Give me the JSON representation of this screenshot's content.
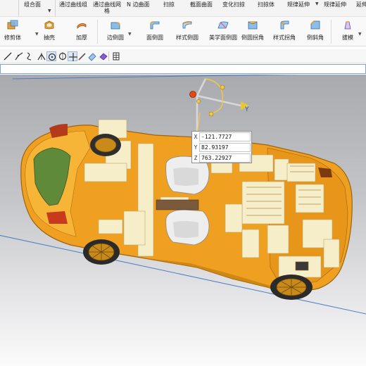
{
  "ribbon_top": {
    "groups": [
      "组合面",
      "通过曲线组",
      "通过曲线网格",
      "N 边曲面",
      "扫掠",
      "截面曲面",
      "变化扫掠",
      "扫掠体",
      "规律延伸",
      "规律延伸",
      "延伸"
    ]
  },
  "ribbon": {
    "buttons": [
      {
        "label": "修剪体",
        "icon": "trim-body-icon"
      },
      {
        "label": "抽壳",
        "icon": "shell-icon"
      },
      {
        "label": "加厚",
        "icon": "thicken-icon"
      },
      {
        "label": "边倒圆",
        "icon": "edge-blend-icon"
      },
      {
        "label": "面倒圆",
        "icon": "face-blend-icon"
      },
      {
        "label": "样式倒圆",
        "icon": "styled-blend-icon"
      },
      {
        "label": "美学面倒圆",
        "icon": "aesthetic-face-blend-icon"
      },
      {
        "label": "倒圆拐角",
        "icon": "blend-corner-icon"
      },
      {
        "label": "样式拐角",
        "icon": "styled-corner-icon"
      },
      {
        "label": "倒斜角",
        "icon": "chamfer-icon"
      },
      {
        "label": "拔模",
        "icon": "draft-icon"
      }
    ]
  },
  "toolbar2": {
    "tools": [
      "line-icon",
      "polyline-icon",
      "curve-icon",
      "corner-icon",
      "circle-center-icon",
      "circle-icon",
      "crosshair-icon",
      "pen-icon",
      "surface-select-icon",
      "shaded-view-icon",
      "grid-icon"
    ]
  },
  "command_input": {
    "value": ""
  },
  "viewport": {
    "axis_label_y": "Y",
    "coords": {
      "x": "-121.7727",
      "y": "82.93197",
      "z": "763.22927"
    },
    "colors": {
      "body": "#f0a020",
      "interior": "#f6eec8",
      "hood": "#5f8a39",
      "accent": "#c83a1c"
    }
  }
}
